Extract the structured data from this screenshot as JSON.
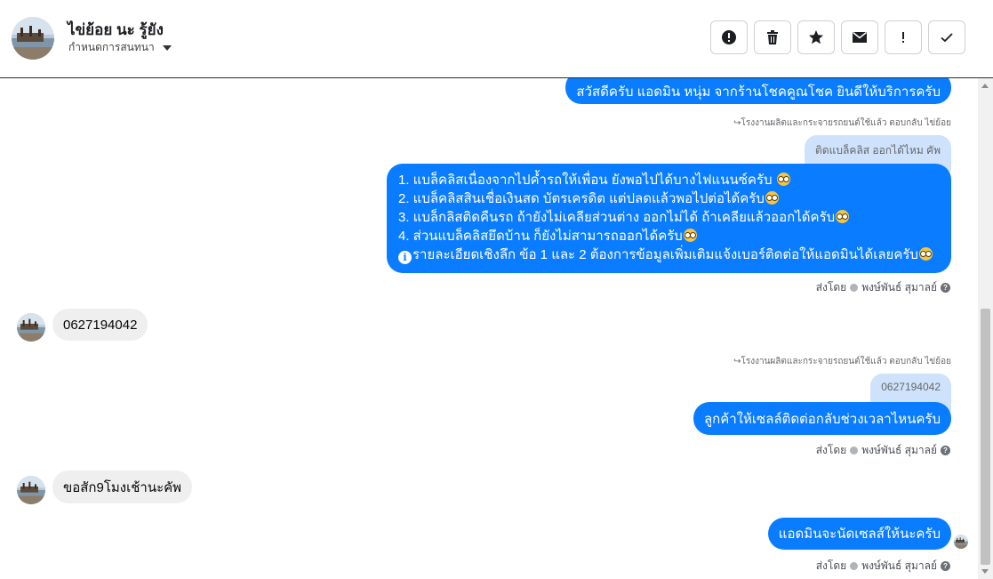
{
  "header": {
    "name": "ไข่ย้อย นะ รู้ยัง",
    "subtitle": "กำหนดการสนทนา"
  },
  "toolbar": [
    {
      "name": "alert-icon",
      "label": "alert"
    },
    {
      "name": "trash-icon",
      "label": "delete"
    },
    {
      "name": "star-icon",
      "label": "star"
    },
    {
      "name": "envelope-icon",
      "label": "mail"
    },
    {
      "name": "exclamation-icon",
      "label": "important"
    },
    {
      "name": "check-icon",
      "label": "done"
    }
  ],
  "messages": {
    "greeting": "สวัสดีครับ แอดมิน หนุ่ม จากร้านโชคคูณโชค ยินดีให้บริการครับ",
    "reply_meta_1": "↪โรงงานผลิตและกระจายรถยนต์ใช้แล้ว ตอบกลับ ไข่ย้อย",
    "quote_1": "ติดแบล็คลิส ออกได้ไหม คัพ",
    "answer_lines": [
      "1. แบล็คลิสเนื่องจากไปค้ำรถให้เพื่อน ยังพอไปได้บางไฟแนนซ์ครับ",
      "2. แบล็คลิสสินเชื่อเงินสด บัตรเครดิต แต่ปลดแล้วพอไปต่อได้ครับ",
      "3. แบล็กลิสติดคืนรถ ถ้ายังไม่เคลียส่วนต่าง ออกไม่ได้ ถ้าเคลียแล้วออกได้ครับ",
      "4. ส่วนแบล็คลิสยึดบ้าน ก็ยังไม่สามารถออกได้ครับ",
      "รายละเอียดเชิงลึก ข้อ 1 และ 2 ต้องการข้อมูลเพิ่มเติมแจ้งเบอร์ติดต่อให้แอดมินได้เลยครับ"
    ],
    "sent_by_1": "ส่งโดย",
    "sender_1": "พงษ์พันธ์ สุมาลย์",
    "incoming_phone": "0627194042",
    "reply_meta_2": "↪โรงงานผลิตและกระจายรถยนต์ใช้แล้ว ตอบกลับ ไข่ย้อย",
    "quote_2": "0627194042",
    "ask_time": "ลูกค้าให้เซลล์ติดต่อกลับช่วงเวลาไหนครับ",
    "sent_by_2": "ส่งโดย",
    "sender_2": "พงษ์พันธ์ สุมาลย์",
    "incoming_time": "ขอสัก9โมงเช้านะคัพ",
    "admin_close": "แอดมินจะนัดเซลส์ให้นะครับ",
    "sent_by_3": "ส่งโดย",
    "sender_3": "พงษ์พันธ์ สุมาลย์"
  },
  "colors": {
    "outgoing": "#0a7cff",
    "incoming": "#efeff0",
    "quote": "#cfe2fb"
  }
}
